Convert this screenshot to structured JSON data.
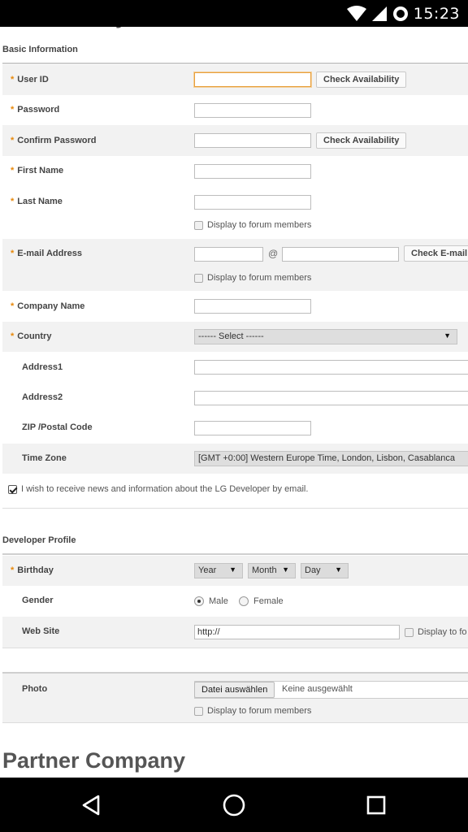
{
  "status_bar": {
    "time": "15:23"
  },
  "partial_heading": "y",
  "basic": {
    "title": "Basic Information",
    "user_id": {
      "label": "User ID",
      "button": "Check Availability"
    },
    "password": {
      "label": "Password"
    },
    "confirm_password": {
      "label": "Confirm Password",
      "button": "Check Availability"
    },
    "first_name": {
      "label": "First Name"
    },
    "last_name": {
      "label": "Last Name",
      "display_check": "Display to forum members"
    },
    "email": {
      "label": "E-mail Address",
      "at": "@",
      "button": "Check E-mail",
      "display_check": "Display to forum members"
    },
    "company": {
      "label": "Company Name"
    },
    "country": {
      "label": "Country",
      "selected": "------ Select ------"
    },
    "address1": {
      "label": "Address1"
    },
    "address2": {
      "label": "Address2"
    },
    "zip": {
      "label": "ZIP /Postal Code"
    },
    "timezone": {
      "label": "Time Zone",
      "selected": "[GMT +0:00] Western Europe Time, London, Lisbon, Casablanca"
    },
    "newsletter": {
      "text": "I wish to receive news and information about the LG Developer by email.",
      "checked": true
    }
  },
  "developer": {
    "title": "Developer Profile",
    "birthday": {
      "label": "Birthday",
      "year": "Year",
      "month": "Month",
      "day": "Day"
    },
    "gender": {
      "label": "Gender",
      "male": "Male",
      "female": "Female",
      "selected": "Male"
    },
    "website": {
      "label": "Web Site",
      "value": "http://",
      "display_check": "Display to fo"
    },
    "photo": {
      "label": "Photo",
      "button": "Datei auswählen",
      "status": "Keine ausgewählt",
      "display_check": "Display to forum members"
    }
  },
  "partner": {
    "title": "Partner Company"
  },
  "icons": {
    "required_marker": "*",
    "dropdown": "▼"
  },
  "colors": {
    "required": "#e8890c",
    "focus": "#e8a03c",
    "shaded_row": "#f2f2f2"
  }
}
